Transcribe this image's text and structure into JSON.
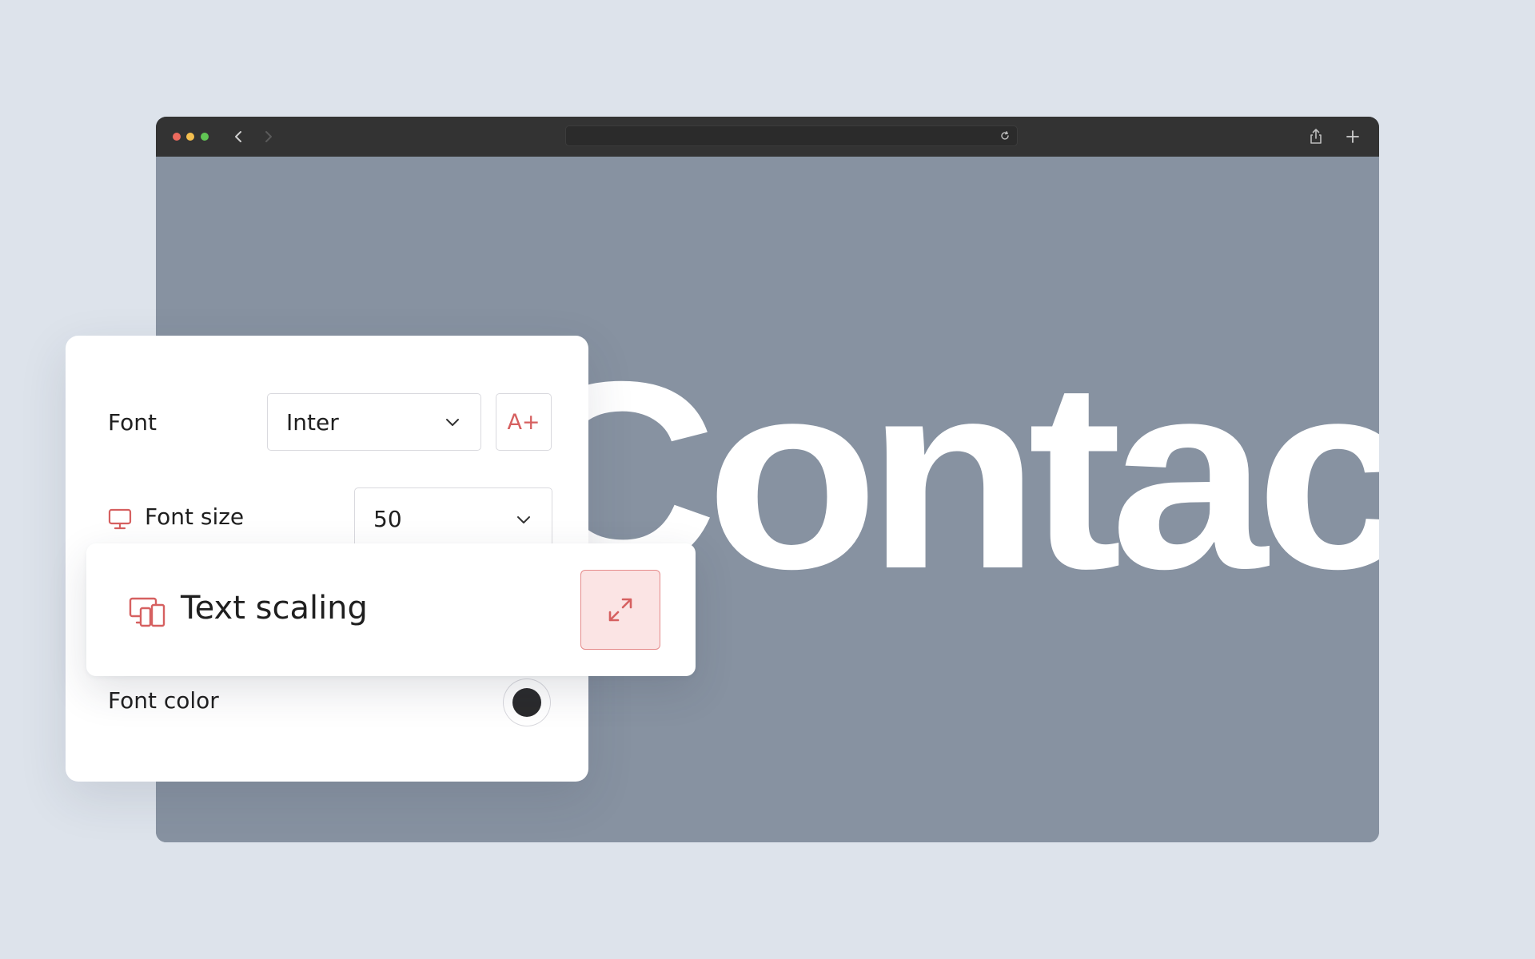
{
  "browser": {
    "page_heading": "Contact"
  },
  "settings": {
    "font_label": "Font",
    "font_value": "Inter",
    "font_plus_label": "A+",
    "font_size_label": "Font size",
    "font_size_value": "50",
    "font_color_label": "Font color",
    "font_color_value": "#2a2a2c",
    "accent_color": "#d66060"
  },
  "scaling": {
    "label": "Text scaling",
    "icon": "devices-icon",
    "button_icon": "expand-icon"
  }
}
